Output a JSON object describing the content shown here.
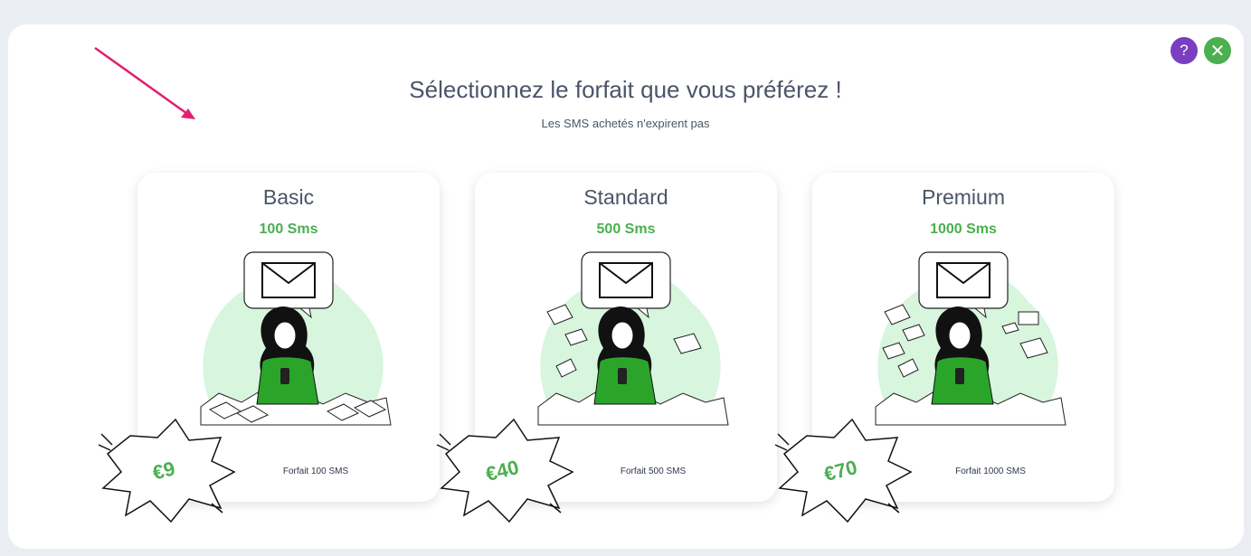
{
  "header": {
    "title": "Sélectionnez le forfait que vous préférez !",
    "subtitle": "Les SMS achetés n'expirent pas"
  },
  "controls": {
    "help_icon": "question-icon",
    "close_icon": "close-icon",
    "help_color": "#7a3fc0",
    "close_color": "#4caf50"
  },
  "colors": {
    "accent": "#4caf50",
    "arrow": "#e0206f",
    "text": "#4a5568"
  },
  "plans": [
    {
      "name": "Basic",
      "quantity": "100 Sms",
      "price": "€9",
      "description": "Forfait 100 SMS"
    },
    {
      "name": "Standard",
      "quantity": "500 Sms",
      "price": "€40",
      "description": "Forfait 500 SMS"
    },
    {
      "name": "Premium",
      "quantity": "1000 Sms",
      "price": "€70",
      "description": "Forfait 1000 SMS"
    }
  ]
}
